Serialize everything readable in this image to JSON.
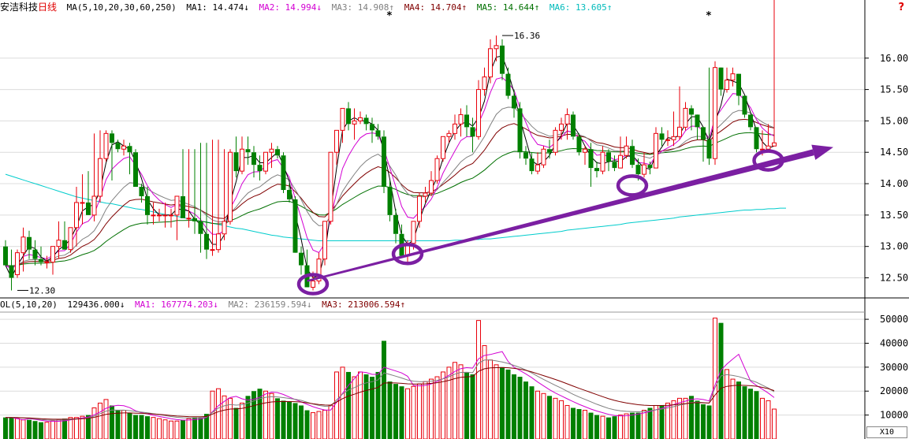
{
  "colors": {
    "up": "#e8000b",
    "down": "#008000",
    "ma5": "#000000",
    "ma10": "#d300d3",
    "ma20": "#808080",
    "ma30": "#800000",
    "ma60": "#007000",
    "ma250": "#00cccc",
    "trend": "#7b1fa2",
    "axis": "#000000",
    "grid": "#dcdcdc"
  },
  "price_header": {
    "stock_name": "安洁科技",
    "period": "日线",
    "ma_params": "MA(5,10,20,30,60,250)",
    "ma1": "MA1: 14.474↓",
    "ma2": "MA2: 14.994↓",
    "ma3": "MA3: 14.908↑",
    "ma4": "MA4: 14.704↑",
    "ma5": "MA5: 14.644↑",
    "ma6": "MA6: 13.605↑"
  },
  "volume_header": {
    "params": "OL(5,10,20)",
    "vol": "129436.000↓",
    "ma1": "MA1: 167774.203↓",
    "ma2": "MA2: 236159.594↓",
    "ma3": "MA3: 213006.594↑"
  },
  "help_icon": "?",
  "x_scale_label": "X10",
  "chart_data": [
    {
      "type": "candlestick",
      "name": "price",
      "y_ticks": [
        12.5,
        13.0,
        13.5,
        14.0,
        14.5,
        15.0,
        15.5,
        16.0
      ],
      "y_tick_labels": [
        "12.50",
        "13.00",
        "13.50",
        "14.00",
        "14.50",
        "15.00",
        "15.50",
        "16.00"
      ],
      "ylim": [
        12.18,
        16.7
      ],
      "annotations": [
        {
          "bar": 2,
          "value": 12.3,
          "label": "12.30"
        },
        {
          "bar": 84,
          "value": 16.36,
          "label": "16.36"
        }
      ],
      "markers": [
        {
          "bar": 65,
          "label": "*"
        },
        {
          "bar": 119,
          "label": "*"
        }
      ],
      "trend_line": {
        "from": [
          51,
          12.45
        ],
        "to": [
          140,
          14.58
        ]
      },
      "ellipses": [
        {
          "bar": 52,
          "value": 12.4
        },
        {
          "bar": 68,
          "value": 12.88
        },
        {
          "bar": 106,
          "value": 13.97
        },
        {
          "bar": 129,
          "value": 14.37
        }
      ],
      "bars": {
        "open": [
          13.0,
          12.7,
          12.55,
          12.9,
          13.15,
          12.95,
          12.8,
          12.75,
          12.75,
          13.0,
          13.1,
          12.95,
          13.3,
          13.7,
          13.7,
          13.5,
          13.8,
          14.4,
          14.8,
          14.65,
          14.55,
          14.6,
          14.5,
          13.95,
          13.8,
          13.5,
          13.5,
          13.5,
          13.5,
          13.5,
          13.8,
          13.45,
          13.45,
          13.4,
          13.2,
          12.95,
          12.95,
          13.2,
          13.4,
          14.5,
          14.2,
          14.55,
          14.5,
          14.3,
          14.2,
          14.5,
          14.55,
          14.45,
          13.9,
          13.75,
          12.9,
          12.7,
          12.35,
          12.45,
          12.8,
          13.4,
          14.5,
          14.85,
          15.2,
          14.95,
          15.0,
          15.05,
          14.95,
          14.85,
          14.75,
          13.95,
          13.5,
          13.2,
          12.85,
          13.05,
          13.4,
          13.8,
          13.85,
          14.05,
          14.4,
          14.75,
          14.8,
          14.95,
          15.1,
          14.9,
          14.75,
          15.5,
          15.7,
          16.15,
          16.2,
          15.75,
          15.4,
          15.2,
          14.5,
          14.4,
          14.2,
          14.3,
          14.55,
          14.5,
          14.85,
          14.95,
          15.1,
          14.75,
          14.5,
          14.55,
          14.25,
          14.2,
          14.5,
          14.35,
          14.25,
          14.45,
          14.6,
          14.3,
          14.15,
          14.3,
          14.25,
          14.8,
          14.7,
          14.7,
          14.75,
          14.9,
          15.2,
          15.1,
          14.9,
          14.7,
          14.4,
          15.85,
          15.5,
          15.65,
          15.75,
          15.4,
          15.1,
          14.9,
          14.55,
          14.55,
          14.6,
          14.7
        ],
        "high": [
          13.1,
          12.95,
          12.95,
          13.3,
          13.25,
          13.1,
          13.0,
          12.85,
          13.0,
          13.4,
          13.4,
          13.3,
          13.95,
          14.15,
          14.2,
          14.8,
          14.85,
          14.85,
          14.85,
          14.7,
          14.7,
          14.65,
          14.55,
          14.0,
          13.95,
          13.7,
          13.6,
          13.7,
          13.6,
          13.6,
          14.55,
          14.55,
          14.55,
          14.65,
          14.65,
          14.7,
          14.7,
          14.55,
          14.55,
          14.75,
          14.75,
          14.75,
          14.6,
          14.45,
          14.5,
          14.65,
          14.6,
          14.5,
          14.0,
          13.8,
          13.0,
          12.95,
          12.6,
          12.9,
          13.4,
          14.5,
          14.8,
          15.1,
          15.3,
          15.2,
          15.15,
          15.1,
          15.05,
          14.95,
          14.85,
          14.05,
          13.6,
          13.35,
          13.1,
          13.4,
          13.85,
          13.95,
          14.2,
          14.45,
          14.75,
          14.85,
          15.1,
          15.2,
          15.25,
          15.05,
          15.65,
          15.85,
          16.3,
          16.36,
          16.3,
          15.85,
          15.5,
          15.3,
          14.6,
          14.5,
          14.5,
          14.6,
          14.7,
          14.9,
          15.05,
          15.2,
          15.15,
          14.8,
          14.6,
          14.65,
          14.35,
          14.6,
          14.55,
          14.45,
          14.75,
          14.75,
          14.7,
          14.4,
          14.5,
          14.35,
          14.9,
          14.9,
          14.85,
          15.15,
          15.55,
          15.3,
          15.25,
          14.95,
          14.8,
          15.85,
          15.95,
          15.8,
          15.85,
          15.85,
          15.45,
          15.15,
          14.95,
          14.85,
          14.85,
          14.95
        ],
        "low": [
          12.75,
          12.3,
          12.5,
          12.6,
          12.8,
          12.7,
          12.7,
          12.65,
          12.55,
          12.8,
          12.95,
          12.9,
          13.0,
          13.35,
          13.6,
          13.4,
          13.7,
          14.35,
          14.05,
          14.5,
          14.45,
          14.15,
          13.95,
          13.7,
          13.35,
          13.35,
          13.4,
          13.3,
          13.3,
          13.1,
          13.45,
          13.3,
          13.2,
          12.9,
          12.8,
          12.85,
          12.9,
          13.1,
          13.35,
          14.1,
          14.15,
          14.3,
          14.1,
          14.05,
          14.15,
          14.25,
          14.4,
          13.85,
          13.7,
          13.1,
          12.55,
          12.55,
          12.3,
          12.4,
          12.7,
          13.35,
          14.3,
          14.65,
          14.85,
          14.7,
          14.95,
          14.85,
          14.65,
          14.7,
          13.85,
          13.4,
          13.05,
          12.85,
          12.75,
          12.95,
          13.3,
          13.7,
          13.8,
          14.0,
          14.35,
          14.65,
          14.7,
          14.75,
          14.75,
          14.5,
          14.7,
          15.4,
          15.6,
          15.95,
          15.65,
          15.35,
          15.05,
          14.4,
          14.3,
          14.15,
          14.15,
          14.25,
          14.4,
          14.45,
          14.7,
          14.7,
          14.7,
          14.45,
          14.3,
          13.95,
          14.1,
          14.15,
          14.2,
          14.2,
          14.25,
          14.4,
          14.25,
          14.05,
          14.1,
          14.15,
          14.25,
          14.6,
          14.6,
          14.6,
          14.7,
          14.85,
          14.85,
          14.7,
          14.35,
          14.3,
          14.3,
          15.4,
          15.45,
          15.55,
          15.25,
          15.05,
          14.85,
          14.5,
          14.45,
          14.55,
          14.6
        ],
        "close": [
          12.7,
          12.5,
          12.9,
          13.15,
          12.95,
          12.8,
          12.75,
          12.75,
          13.0,
          13.1,
          12.95,
          13.3,
          13.7,
          13.7,
          13.5,
          13.8,
          14.4,
          14.8,
          14.65,
          14.55,
          14.6,
          14.5,
          13.95,
          13.8,
          13.5,
          13.5,
          13.5,
          13.5,
          13.5,
          13.8,
          13.45,
          13.45,
          13.4,
          13.2,
          12.95,
          12.95,
          13.2,
          13.4,
          14.5,
          14.2,
          14.55,
          14.5,
          14.3,
          14.2,
          14.5,
          14.55,
          14.45,
          13.9,
          13.75,
          12.9,
          12.7,
          12.35,
          12.45,
          12.8,
          13.4,
          14.5,
          14.85,
          15.2,
          14.95,
          15.0,
          15.05,
          14.95,
          14.85,
          14.75,
          13.95,
          13.5,
          13.2,
          12.85,
          13.05,
          13.4,
          13.8,
          13.85,
          14.05,
          14.4,
          14.75,
          14.8,
          14.95,
          15.1,
          14.9,
          14.75,
          15.5,
          15.7,
          16.15,
          16.2,
          15.75,
          15.4,
          15.2,
          14.5,
          14.4,
          14.2,
          14.3,
          14.55,
          14.5,
          14.85,
          14.95,
          15.1,
          14.75,
          14.5,
          14.55,
          14.25,
          14.2,
          14.5,
          14.35,
          14.25,
          14.45,
          14.6,
          14.3,
          14.15,
          14.3,
          14.25,
          14.8,
          14.7,
          14.7,
          14.75,
          14.9,
          15.2,
          15.1,
          14.9,
          14.7,
          14.4,
          15.85,
          15.5,
          15.65,
          15.75,
          15.4,
          15.1,
          14.9,
          14.55,
          14.55,
          14.6,
          14.65
        ],
        "ma250": [
          14.15,
          14.12,
          14.09,
          14.06,
          14.03,
          14.0,
          13.97,
          13.94,
          13.91,
          13.88,
          13.85,
          13.82,
          13.79,
          13.77,
          13.75,
          13.73,
          13.71,
          13.69,
          13.68,
          13.66,
          13.64,
          13.62,
          13.6,
          13.59,
          13.57,
          13.55,
          13.53,
          13.51,
          13.5,
          13.48,
          13.46,
          13.44,
          13.42,
          13.4,
          13.39,
          13.37,
          13.35,
          13.33,
          13.31,
          13.29,
          13.28,
          13.26,
          13.24,
          13.22,
          13.2,
          13.18,
          13.17,
          13.15,
          13.14,
          13.13,
          13.12,
          13.11,
          13.1,
          13.09,
          13.09,
          13.09,
          13.09,
          13.09,
          13.09,
          13.09,
          13.09,
          13.09,
          13.09,
          13.09,
          13.09,
          13.09,
          13.09,
          13.09,
          13.09,
          13.09,
          13.09,
          13.09,
          13.09,
          13.09,
          13.09,
          13.09,
          13.1,
          13.1,
          13.1,
          13.11,
          13.11,
          13.12,
          13.12,
          13.13,
          13.14,
          13.15,
          13.16,
          13.17,
          13.18,
          13.19,
          13.2,
          13.21,
          13.22,
          13.23,
          13.24,
          13.26,
          13.27,
          13.28,
          13.29,
          13.3,
          13.31,
          13.32,
          13.33,
          13.34,
          13.35,
          13.37,
          13.38,
          13.39,
          13.4,
          13.41,
          13.42,
          13.43,
          13.44,
          13.45,
          13.47,
          13.48,
          13.49,
          13.5,
          13.51,
          13.52,
          13.53,
          13.54,
          13.55,
          13.56,
          13.57,
          13.58,
          13.58,
          13.59,
          13.59,
          13.6,
          13.6,
          13.61,
          13.61
        ]
      }
    },
    {
      "type": "bar",
      "name": "volume",
      "y_ticks": [
        10000,
        20000,
        30000,
        40000,
        50000
      ],
      "y_tick_labels": [
        "10000",
        "20000",
        "30000",
        "40000",
        "50000"
      ],
      "ylim": [
        0,
        53000
      ],
      "values": [
        9000,
        9000,
        8500,
        8000,
        8000,
        7500,
        7000,
        7000,
        7500,
        8000,
        8500,
        9000,
        9000,
        9500,
        10000,
        13000,
        15000,
        16500,
        14000,
        12000,
        12000,
        11000,
        10000,
        10000,
        9500,
        9000,
        8500,
        8000,
        7500,
        7500,
        8000,
        8500,
        9000,
        9000,
        10500,
        20000,
        21000,
        18000,
        17000,
        13000,
        15000,
        18000,
        20000,
        21000,
        20000,
        19000,
        17000,
        16000,
        15500,
        15000,
        14000,
        12000,
        11000,
        11500,
        12000,
        14000,
        28000,
        30000,
        28000,
        26000,
        28000,
        27000,
        26000,
        28000,
        41000,
        24000,
        23000,
        22000,
        21000,
        22000,
        23000,
        24000,
        25000,
        26000,
        28000,
        30000,
        32000,
        31000,
        28000,
        27000,
        49500,
        39000,
        33000,
        31000,
        30000,
        29000,
        27000,
        26000,
        24000,
        22000,
        20000,
        19000,
        18000,
        17000,
        16000,
        14000,
        13000,
        12500,
        12000,
        11000,
        10000,
        9500,
        9000,
        9500,
        10000,
        10500,
        11000,
        11000,
        12000,
        13000,
        14000,
        14000,
        15000,
        16000,
        17000,
        17000,
        18000,
        16000,
        14500,
        14000,
        50500,
        48500,
        29000,
        25000,
        24000,
        22000,
        21000,
        20000,
        17000,
        16000,
        12500
      ]
    }
  ]
}
